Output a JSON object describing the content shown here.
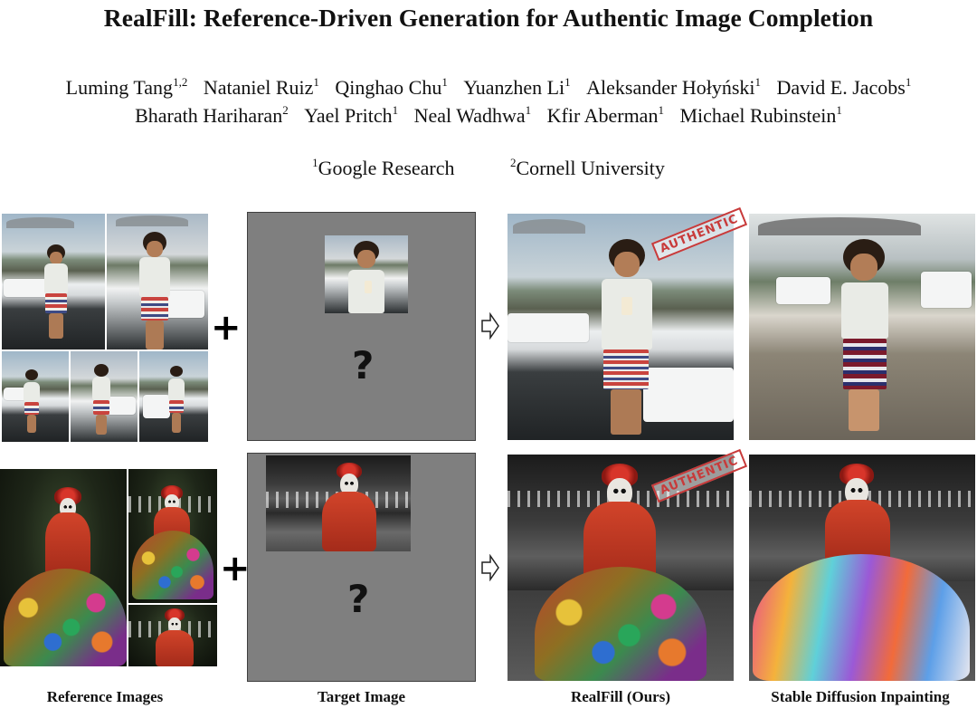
{
  "paper": {
    "title": "RealFill: Reference-Driven Generation for Authentic Image Completion",
    "authors_row1": [
      {
        "name": "Luming Tang",
        "sup": "1,2"
      },
      {
        "name": "Nataniel Ruiz",
        "sup": "1"
      },
      {
        "name": "Qinghao Chu",
        "sup": "1"
      },
      {
        "name": "Yuanzhen Li",
        "sup": "1"
      },
      {
        "name": "Aleksander Hołyński",
        "sup": "1"
      },
      {
        "name": "David E. Jacobs",
        "sup": "1"
      }
    ],
    "authors_row2": [
      {
        "name": "Bharath Hariharan",
        "sup": "2"
      },
      {
        "name": "Yael Pritch",
        "sup": "1"
      },
      {
        "name": "Neal Wadhwa",
        "sup": "1"
      },
      {
        "name": "Kfir Aberman",
        "sup": "1"
      },
      {
        "name": "Michael Rubinstein",
        "sup": "1"
      }
    ],
    "affiliations": [
      {
        "sup": "1",
        "name": "Google Research"
      },
      {
        "sup": "2",
        "name": "Cornell University"
      }
    ]
  },
  "figure": {
    "plus_symbol": "+",
    "question_mark": "?",
    "stamp_text": "AUTHENTIC",
    "captions": {
      "reference": "Reference Images",
      "target": "Target Image",
      "realfill": "RealFill (Ours)",
      "sd": "Stable Diffusion Inpainting"
    }
  }
}
